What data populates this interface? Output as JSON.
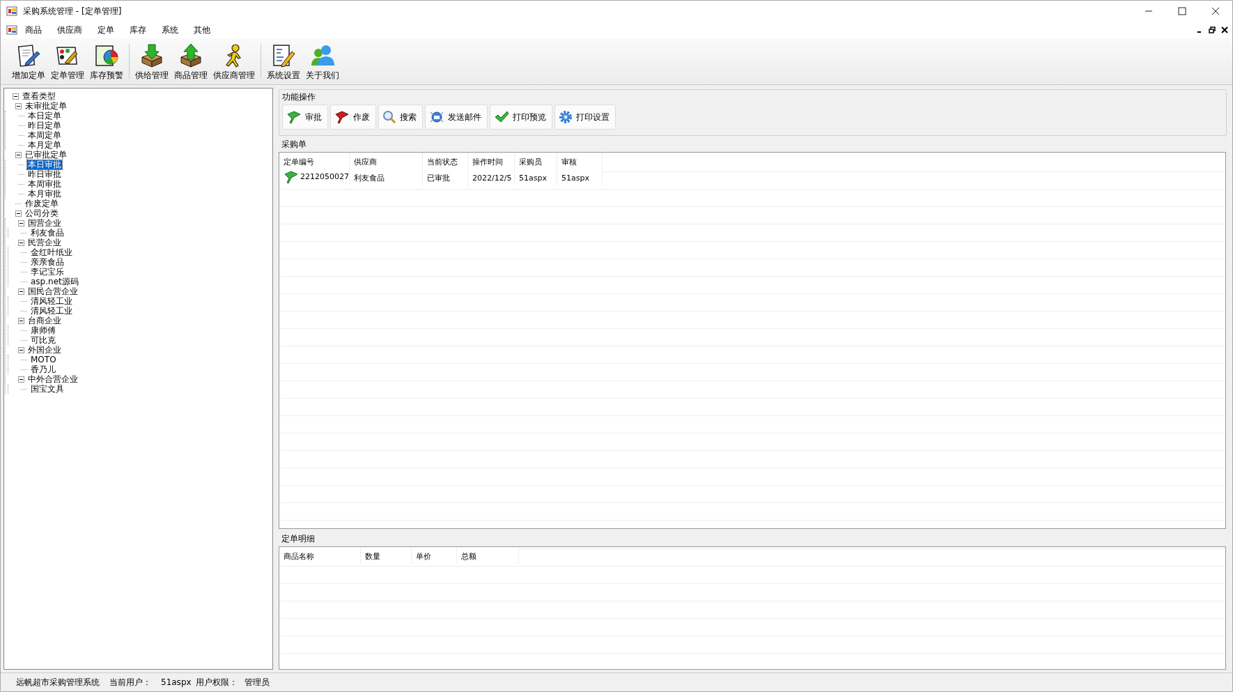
{
  "window": {
    "title": "采购系统管理 - [定单管理]"
  },
  "menu": [
    "商品",
    "供应商",
    "定单",
    "库存",
    "系统",
    "其他"
  ],
  "toolbar": [
    [
      "增加定单",
      "定单管理",
      "库存预警"
    ],
    [
      "供给管理",
      "商品管理",
      "供应商管理"
    ],
    [
      "系统设置",
      "关于我们"
    ]
  ],
  "tree": [
    {
      "label": "查看类型",
      "expanded": true,
      "selected": false,
      "children": [
        {
          "label": "未审批定单",
          "expanded": true,
          "selected": false,
          "children": [
            {
              "label": "本日定单",
              "selected": false
            },
            {
              "label": "昨日定单",
              "selected": false
            },
            {
              "label": "本周定单",
              "selected": false
            },
            {
              "label": "本月定单",
              "selected": false
            }
          ]
        },
        {
          "label": "已审批定单",
          "expanded": true,
          "selected": false,
          "children": [
            {
              "label": "本日审批",
              "selected": true
            },
            {
              "label": "昨日审批",
              "selected": false
            },
            {
              "label": "本周审批",
              "selected": false
            },
            {
              "label": "本月审批",
              "selected": false
            }
          ]
        },
        {
          "label": "作废定单",
          "selected": false
        },
        {
          "label": "公司分类",
          "expanded": true,
          "selected": false,
          "children": [
            {
              "label": "国营企业",
              "expanded": true,
              "selected": false,
              "children": [
                {
                  "label": "利友食品",
                  "selected": false
                }
              ]
            },
            {
              "label": "民营企业",
              "expanded": true,
              "selected": false,
              "children": [
                {
                  "label": "金红叶纸业",
                  "selected": false
                },
                {
                  "label": "亲亲食品",
                  "selected": false
                },
                {
                  "label": "李记宝乐",
                  "selected": false
                },
                {
                  "label": "asp.net源码",
                  "selected": false
                }
              ]
            },
            {
              "label": "国民合营企业",
              "expanded": true,
              "selected": false,
              "children": [
                {
                  "label": "清风轻工业",
                  "selected": false
                },
                {
                  "label": "清风轻工业",
                  "selected": false
                }
              ]
            },
            {
              "label": "台商企业",
              "expanded": true,
              "selected": false,
              "children": [
                {
                  "label": "康师傅",
                  "selected": false
                },
                {
                  "label": "可比克",
                  "selected": false
                }
              ]
            },
            {
              "label": "外国企业",
              "expanded": true,
              "selected": false,
              "children": [
                {
                  "label": "MOTO",
                  "selected": false
                },
                {
                  "label": "香乃儿",
                  "selected": false
                }
              ]
            },
            {
              "label": "中外合营企业",
              "expanded": true,
              "selected": false,
              "children": [
                {
                  "label": "国宝文具",
                  "selected": false
                }
              ]
            }
          ]
        }
      ]
    }
  ],
  "functions": {
    "title": "功能操作",
    "buttons": [
      "审批",
      "作废",
      "搜索",
      "发送邮件",
      "打印预览",
      "打印设置"
    ]
  },
  "orders": {
    "title": "采购单",
    "columns": [
      "定单编号",
      "供应商",
      "当前状态",
      "操作时间",
      "采购员",
      "审核"
    ],
    "rows": [
      {
        "cells": [
          "2212050027",
          "利友食品",
          "已审批",
          "2022/12/5",
          "51aspx",
          "51aspx"
        ]
      }
    ]
  },
  "details": {
    "title": "定单明细",
    "columns": [
      "商品名称",
      "数量",
      "单价",
      "总额"
    ]
  },
  "status_bar": [
    "远帆超市采购管理系统",
    "当前用户：",
    "51aspx",
    "用户权限：",
    "管理员"
  ]
}
